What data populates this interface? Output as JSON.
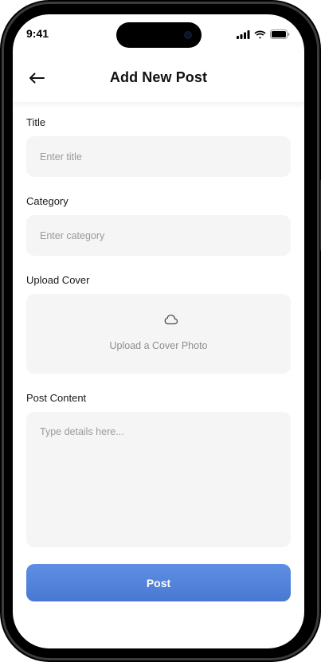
{
  "status_bar": {
    "time": "9:41",
    "icons": [
      "signal-icon",
      "wifi-icon",
      "battery-icon"
    ]
  },
  "header": {
    "back_icon": "arrow-left-icon",
    "title": "Add New Post"
  },
  "form": {
    "title": {
      "label": "Title",
      "placeholder": "Enter title",
      "value": ""
    },
    "category": {
      "label": "Category",
      "placeholder": "Enter category",
      "value": ""
    },
    "cover": {
      "label": "Upload Cover",
      "icon": "cloud-icon",
      "prompt": "Upload a Cover Photo"
    },
    "content": {
      "label": "Post Content",
      "placeholder": "Type details here...",
      "value": ""
    }
  },
  "actions": {
    "post_label": "Post"
  },
  "colors": {
    "primary_button": "#5583DB",
    "input_background": "#F5F5F5",
    "screen_background": "#FFFFFF",
    "device_frame": "#000000"
  }
}
